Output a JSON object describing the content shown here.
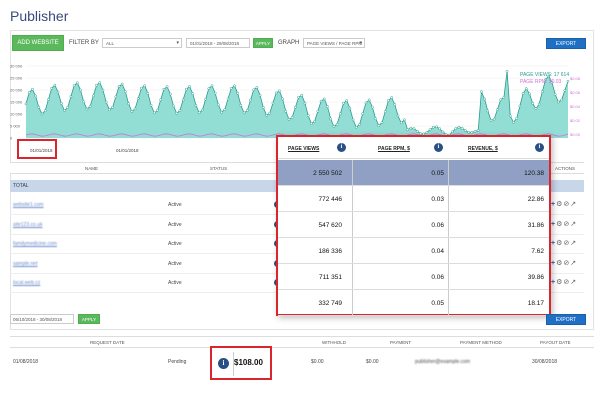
{
  "page": {
    "title": "Publisher"
  },
  "toolbar": {
    "add_website": "ADD WEBSITE",
    "filter_by_label": "FILTER BY",
    "filter_value": "ALL",
    "date_range": "01/01/2018 - 29/08/2018",
    "apply": "APPLY",
    "graph_label": "GRAPH",
    "graph_value": "PAGE VIEWS / PAGE RPM",
    "export": "EXPORT"
  },
  "chart": {
    "y_ticks": [
      "30 000",
      "25 000",
      "20 000",
      "15 000",
      "10 000",
      "5 000",
      "0"
    ],
    "x_start": "01/01/2018",
    "x_end": "29/08/2018",
    "legend_pageviews": "PAGE VIEWS: 17 614",
    "legend_rpm": "PAGE RPM: $0.03",
    "right_ticks": [
      "$0.08",
      "$0.06",
      "$0.04",
      "$0.02",
      "$0.00"
    ],
    "colors": {
      "pageviews_fill": "#7fd8cc",
      "pageviews_line": "#2b9c8d",
      "rpm_line": "#d070d8"
    }
  },
  "table": {
    "headers": {
      "name": "NAME",
      "status": "STATUS",
      "actions": "ACTIONS"
    },
    "total_label": "TOTAL",
    "rows": [
      {
        "site": "website1.com",
        "status": "Active"
      },
      {
        "site": "site123.co.uk",
        "status": "Active"
      },
      {
        "site": "familymedicine.com",
        "status": "Active"
      },
      {
        "site": "sample.net",
        "status": "Active"
      },
      {
        "site": "local.web.cz",
        "status": "Active"
      }
    ]
  },
  "overlay": {
    "headers": [
      "PAGE VIEWS",
      "PAGE RPM, $",
      "REVENUE, $"
    ],
    "rows": [
      [
        "2 550 502",
        "0.05",
        "120.38"
      ],
      [
        "772 446",
        "0.03",
        "22.86"
      ],
      [
        "547 620",
        "0.06",
        "31.86"
      ],
      [
        "186 336",
        "0.04",
        "7.62"
      ],
      [
        "711 351",
        "0.06",
        "39.86"
      ],
      [
        "332 749",
        "0.05",
        "18.17"
      ]
    ]
  },
  "bottom": {
    "date_range": "06/10/2018 - 30/08/2018",
    "apply": "APPLY",
    "export": "EXPORT"
  },
  "payments": {
    "headers": [
      "REQUEST DATE",
      "WITHHOLD",
      "PAYMENT",
      "PAYMENT METHOD",
      "PAYOUT DATE"
    ],
    "row": {
      "request_date": "01/08/2018",
      "status": "Pending",
      "amount": "$108.00",
      "withhold": "$0.00",
      "payment": "$0.00",
      "method": "publisher@example.com",
      "payout_date": "30/08/2018"
    }
  }
}
